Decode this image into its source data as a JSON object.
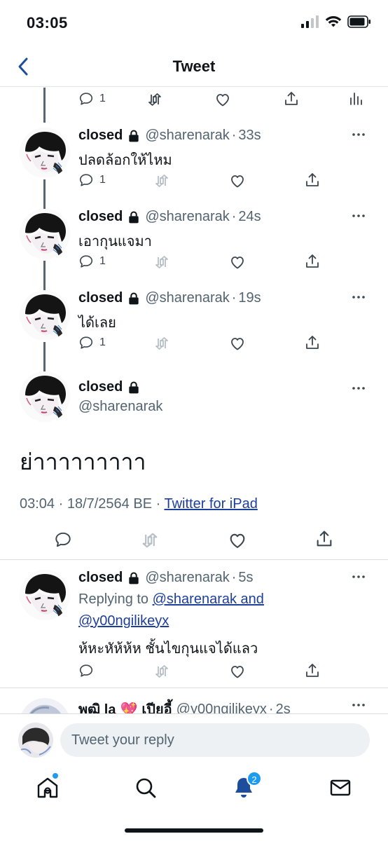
{
  "status_bar": {
    "time": "03:05"
  },
  "header": {
    "title": "Tweet"
  },
  "thread": [
    {
      "name": "closed",
      "handle": "@sharenarak",
      "time": "33s",
      "text": "ปลดล้อกให้ไหม",
      "reply_count": "1"
    },
    {
      "name": "closed",
      "handle": "@sharenarak",
      "time": "24s",
      "text": "เอากุนแจมา",
      "reply_count": "1"
    },
    {
      "name": "closed",
      "handle": "@sharenarak",
      "time": "19s",
      "text": "ได้เลย",
      "reply_count": "1"
    }
  ],
  "top_partial": {
    "reply_count": "1"
  },
  "main_tweet": {
    "name": "closed",
    "handle": "@sharenarak",
    "text": "ย่าาาาาาาาา",
    "timestamp": "03:04 · 18/7/2564 BE · ",
    "source": "Twitter for iPad"
  },
  "reply_tweet": {
    "name": "closed",
    "handle": "@sharenarak",
    "time": "5s",
    "replying_prefix": "Replying to ",
    "replying_to_1": "@sharenarak and",
    "replying_to_2": "@y00ngilikeyx",
    "text": "ห้หะหัห้ห้ห ชั้นไขกุนแจได้แลว"
  },
  "partial_tweet": {
    "name": "พูฒิ la",
    "emoji": "💖",
    "name2": "เปียอี้",
    "handle": "@y00ngilikeyx",
    "time": "2s"
  },
  "reply_bar": {
    "placeholder": "Tweet your reply"
  },
  "tab_bar": {
    "notification_count": "2"
  },
  "colors": {
    "link": "#1d3f9b",
    "accent": "#1d9bf0",
    "text": "#0f1419",
    "muted": "#536471"
  }
}
